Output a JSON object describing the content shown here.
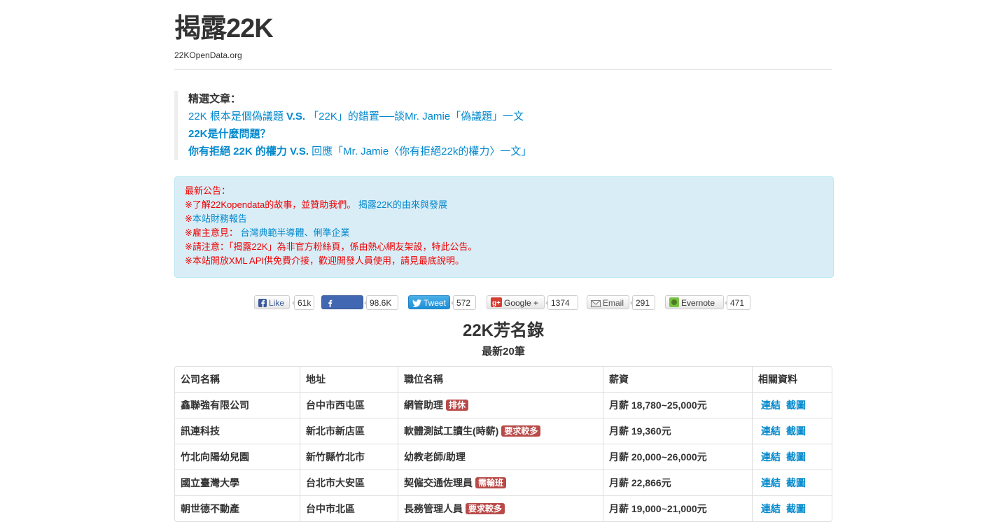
{
  "header": {
    "title": "揭露22K",
    "subtitle": "22KOpenData.org"
  },
  "featured": {
    "heading": "精選文章：",
    "links": [
      {
        "a": "22K 根本是個偽議題 ",
        "vs": "V.S.",
        "b": " 「22K」的錯置──談Mr. Jamie「偽議題」一文"
      },
      {
        "a": "22K是什麼問題？",
        "vs": "",
        "b": ""
      },
      {
        "a": "你有拒絕 22K 的權力 ",
        "vs": "V.S.",
        "b": " 回應「Mr. Jamie〈你有拒絕22k的權力〉一文」"
      }
    ]
  },
  "notice": {
    "heading": "最新公告：",
    "line1_prefix": "※了解22Kopendata的故事，並贊助我們。 ",
    "line1_link": "揭露22K的由來與發展",
    "line2_prefix": "※",
    "line2_link": "本站財務報告",
    "line3_prefix": "※雇主意見： ",
    "line3_link": "台灣典範半導體、俐準企業",
    "line4": "※請注意：「揭露22K」為非官方粉絲頁，係由熱心網友架設，特此公告。",
    "line5": "※本站開放XML API供免費介接，歡迎開發人員使用，請見最底說明。"
  },
  "social": {
    "like_label": "Like",
    "like_count": "61k",
    "share_label": "Share",
    "share_count": "98.6K",
    "tweet_label": "Tweet",
    "tweet_count": "572",
    "google_label": "Google +",
    "google_count": "1374",
    "email_label": "Email",
    "email_count": "291",
    "evernote_label": "Evernote",
    "evernote_count": "471"
  },
  "section": {
    "title": "22K芳名錄",
    "subtitle": "最新20筆"
  },
  "table": {
    "headers": [
      "公司名稱",
      "地址",
      "職位名稱",
      "薪資",
      "相關資料"
    ],
    "rows": [
      {
        "company": "鑫聯強有限公司",
        "address": "台中市西屯區",
        "position": "網管助理",
        "tag": "排休",
        "salary": "月薪 18,780~25,000元",
        "link": "連結",
        "shot": "截圖"
      },
      {
        "company": "訊連科技",
        "address": "新北市新店區",
        "position": "軟體測試工讀生(時薪)",
        "tag": "要求較多",
        "salary": "月薪 19,360元",
        "link": "連結",
        "shot": "截圖"
      },
      {
        "company": "竹北向陽幼兒園",
        "address": "新竹縣竹北市",
        "position": "幼教老師/助理",
        "tag": "",
        "salary": "月薪 20,000~26,000元",
        "link": "連結",
        "shot": "截圖"
      },
      {
        "company": "國立臺灣大學",
        "address": "台北市大安區",
        "position": "契僱交通佐理員",
        "tag": "需輪班",
        "salary": "月薪 22,866元",
        "link": "連結",
        "shot": "截圖"
      },
      {
        "company": "朝世德不動產",
        "address": "台中市北區",
        "position": "長務管理人員",
        "tag": "要求較多",
        "salary": "月薪 19,000~21,000元",
        "link": "連結",
        "shot": "截圖"
      }
    ]
  },
  "colors": {
    "link": "#0088cc",
    "notice_bg": "#d9edf7",
    "notice_red": "#ee0000",
    "label": "#b94a48"
  }
}
